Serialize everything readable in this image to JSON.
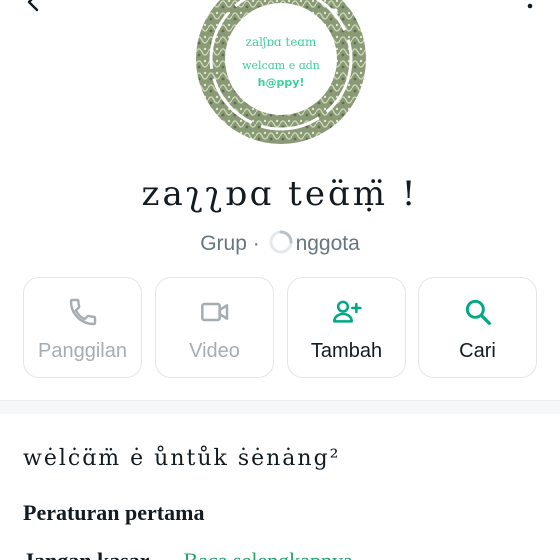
{
  "colors": {
    "accent": "#00a884",
    "disabled_icon": "#a5adb2",
    "text_primary": "#111b21",
    "text_secondary": "#667781"
  },
  "header": {
    "back_icon": "arrow-left-icon",
    "menu_icon": "more-vertical-icon"
  },
  "avatar": {
    "line1": "zalʃɒɑ teɑm",
    "line2": "welcɑm e ɑdn",
    "line3": "h@ppy!"
  },
  "group": {
    "name": "zaʅʅɒɑ teɑ̈ṃ̈ !",
    "sub_prefix": "Grup · ",
    "sub_suffix": "nggota"
  },
  "actions": [
    {
      "label": "Panggilan",
      "icon": "phone-icon",
      "enabled": false
    },
    {
      "label": "Video",
      "icon": "video-icon",
      "enabled": false
    },
    {
      "label": "Tambah",
      "icon": "add-person-icon",
      "enabled": true
    },
    {
      "label": "Cari",
      "icon": "search-icon",
      "enabled": true
    }
  ],
  "description": {
    "line1": "wėlċɑ̈m̈ ė ůntůk ṡėnȧng²",
    "rules_title": "Peraturan pertama",
    "partial_line_prefix": "Jangan kasar",
    "partial_line_link": "Baca selengkapnya"
  }
}
